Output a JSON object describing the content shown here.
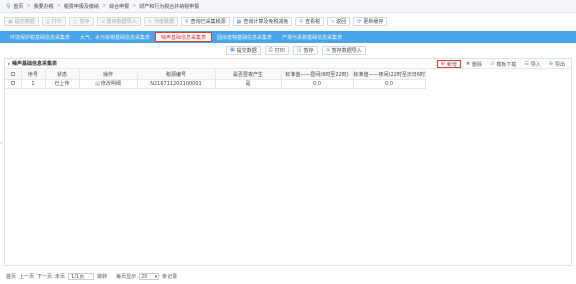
{
  "breadcrumb": {
    "items": [
      "首页",
      "我要办税",
      "税费申报及缴纳",
      "综合申报",
      "财产和行为税合并纳税申报"
    ]
  },
  "toolbar1": {
    "buttons": [
      {
        "label": "提交数据",
        "icon": "submit-icon",
        "disabled": true
      },
      {
        "label": "打印",
        "icon": "print-icon",
        "disabled": true
      },
      {
        "label": "暂存",
        "icon": "save-icon",
        "disabled": true
      },
      {
        "label": "暂存数据导入",
        "icon": "import-icon",
        "disabled": true
      },
      {
        "label": "作废数据",
        "icon": "delete-icon",
        "disabled": true
      },
      {
        "label": "查询已采集税源",
        "icon": "search-icon",
        "disabled": false
      },
      {
        "label": "查询计算及免税减免",
        "icon": "calc-icon",
        "disabled": false
      },
      {
        "label": "查看税",
        "icon": "search-icon",
        "disabled": false
      },
      {
        "label": "返回",
        "icon": "back-icon",
        "disabled": false
      },
      {
        "label": "更新缓存",
        "icon": "refresh-icon",
        "disabled": false
      }
    ]
  },
  "tabs": [
    {
      "label": "环境保护税基础信息采集表",
      "active": false
    },
    {
      "label": "大气、水污染物基础信息采集表",
      "active": false
    },
    {
      "label": "噪声基础信息采集表",
      "active": true
    },
    {
      "label": "固体废物基础信息采集表",
      "active": false
    },
    {
      "label": "产排污系数基础信息采集表",
      "active": false
    }
  ],
  "toolbar2": {
    "buttons": [
      {
        "label": "提交数据",
        "icon": "submit-icon"
      },
      {
        "label": "打印",
        "icon": "print-icon"
      },
      {
        "label": "暂存",
        "icon": "save-icon"
      },
      {
        "label": "暂存数据导入",
        "icon": "import-icon"
      }
    ]
  },
  "panel": {
    "title": "噪声基础信息采集表",
    "actions": [
      {
        "label": "新增",
        "icon": "add-icon",
        "highlight": true
      },
      {
        "label": "删除",
        "icon": "delete-icon",
        "highlight": false
      },
      {
        "label": "模板下载",
        "icon": "download-icon",
        "highlight": false
      },
      {
        "label": "导入",
        "icon": "import-icon",
        "highlight": false
      },
      {
        "label": "导出",
        "icon": "export-icon",
        "highlight": false
      }
    ]
  },
  "table": {
    "columns": [
      "",
      "序号",
      "状态",
      "操作",
      "税源编号",
      "是否昼夜产生",
      "标准值——昼间(6时至22时)",
      "标准值——夜间(22时至次日6时)"
    ],
    "rows": [
      {
        "index": "1",
        "status": "已上传",
        "action": "修改明细",
        "source_no": "N216711202100001",
        "day_night": "是",
        "day_std": "0.0",
        "night_std": "0.0"
      }
    ]
  },
  "pager": {
    "first": "首页",
    "prev": "上一页",
    "next": "下一页",
    "last": "末页",
    "page_value": "1/1页",
    "goto": "跳转",
    "per_page_label": "每页显示",
    "per_page_value": "20",
    "records_label": "条记录"
  }
}
